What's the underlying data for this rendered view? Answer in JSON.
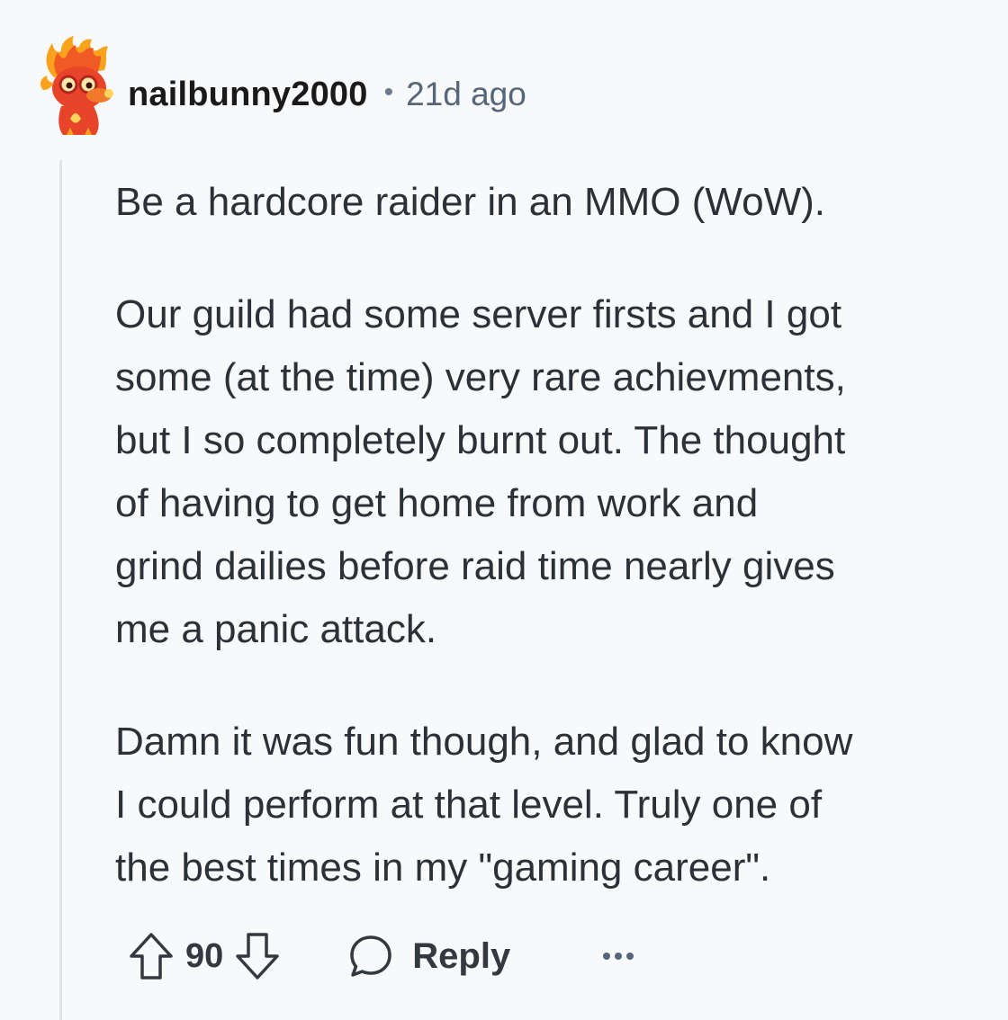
{
  "comment": {
    "author": "nailbunny2000",
    "separator": "•",
    "timestamp": "21d ago",
    "paragraphs": [
      "Be a hardcore raider in an MMO (WoW).",
      "Our guild had some server firsts and I got\nsome (at the time) very rare achievments,\nbut I so completely burnt out. The thought\nof having to get home from work and\ngrind dailies before raid time nearly gives\nme a panic attack.",
      "Damn it was fun though, and glad to know\nI could perform at that level. Truly one of\nthe best times in my \"gaming career\"."
    ],
    "vote_count": "90",
    "reply_label": "Reply"
  },
  "icons": {
    "avatar": "fire-mascot-avatar",
    "upvote": "arrow-up-icon",
    "downvote": "arrow-down-icon",
    "reply": "speech-bubble-icon",
    "more": "ellipsis-icon"
  },
  "colors": {
    "background": "#f7f9fb",
    "text": "#2b3137",
    "muted": "#55667a",
    "avatar_flame": "#f05a24"
  }
}
